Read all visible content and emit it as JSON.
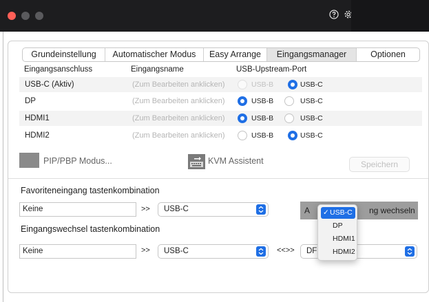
{
  "tabs": [
    {
      "label": "Grundeinstellung"
    },
    {
      "label": "Automatischer Modus"
    },
    {
      "label": "Easy Arrange"
    },
    {
      "label": "Eingangsmanager",
      "active": true
    },
    {
      "label": "Optionen"
    }
  ],
  "columns": {
    "port": "Eingangsanschluss",
    "name": "Eingangsname",
    "upstream": "USB-Upstream-Port"
  },
  "rows": [
    {
      "port": "USB-C (Aktiv)",
      "name_placeholder": "(Zum Bearbeiten anklicken)",
      "usb_b_label": "USB-B",
      "usb_c_label": "USB-C",
      "selected": "USB-C",
      "usb_b_disabled": true
    },
    {
      "port": "DP",
      "name_placeholder": "(Zum Bearbeiten anklicken)",
      "usb_b_label": "USB-B",
      "usb_c_label": "USB-C",
      "selected": "USB-B"
    },
    {
      "port": "HDMI1",
      "name_placeholder": "(Zum Bearbeiten anklicken)",
      "usb_b_label": "USB-B",
      "usb_c_label": "USB-C",
      "selected": "USB-B"
    },
    {
      "port": "HDMI2",
      "name_placeholder": "(Zum Bearbeiten anklicken)",
      "usb_b_label": "USB-B",
      "usb_c_label": "USB-C",
      "selected": "USB-C"
    }
  ],
  "tools": {
    "pip_label": "PIP/PBP Modus...",
    "kvm_label": "KVM Assistent",
    "save_label": "Speichern"
  },
  "favorite": {
    "label": "Favoriteneingang tastenkombination",
    "shortcut": "Keine",
    "arrow": ">>",
    "input": "USB-C",
    "button_left": "A",
    "button_right": "ng wechseln"
  },
  "switch": {
    "label": "Eingangswechsel tastenkombination",
    "shortcut": "Keine",
    "arrow": ">>",
    "input": "USB-C",
    "swap": "<<>>",
    "input2_partial": "DF"
  },
  "dropdown": {
    "check": "✓",
    "options": [
      "USB-C",
      "DP",
      "HDMI1",
      "HDMI2"
    ],
    "selected": "USB-C"
  },
  "colors": {
    "accent": "#1f6fe5",
    "titlebar": "#1d1d1f",
    "close": "#ff5f57"
  },
  "icons": [
    "help-icon",
    "gear-icon",
    "kvm-icon",
    "chevron-updown-icon",
    "checkmark-icon"
  ]
}
